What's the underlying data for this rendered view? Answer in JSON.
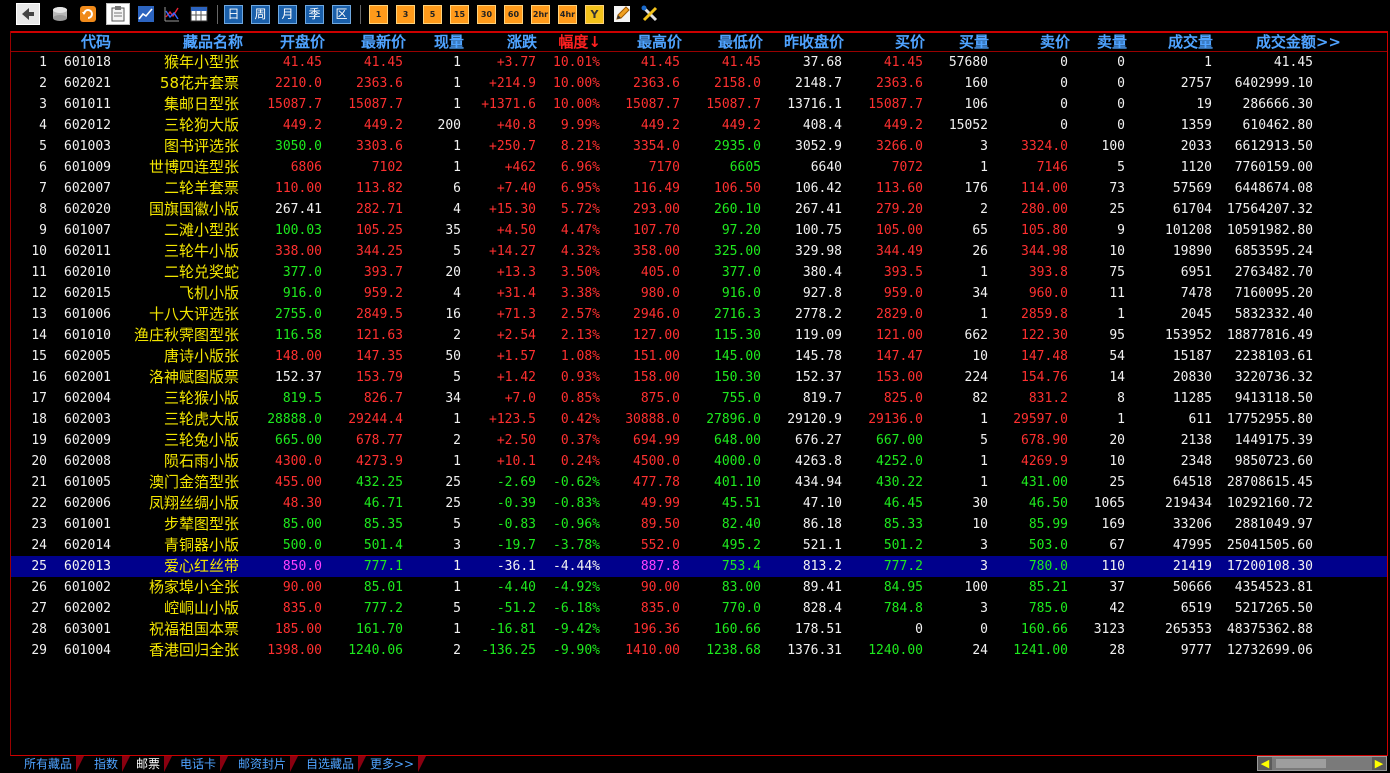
{
  "toolbar": {
    "period_buttons": [
      "日",
      "周",
      "月",
      "季",
      "区"
    ],
    "minute_buttons": [
      "1",
      "3",
      "5",
      "15",
      "30",
      "60",
      "2hr",
      "4hr",
      "Y"
    ]
  },
  "columns": [
    "代码",
    "藏品名称",
    "开盘价",
    "最新价",
    "现量",
    "涨跌",
    "幅度↓",
    "最高价",
    "最低价",
    "昨收盘价",
    "买价",
    "买量",
    "卖价",
    "卖量",
    "成交量",
    "成交金额>>"
  ],
  "colors": {
    "up": "#ff3030",
    "down": "#1eea1e",
    "flat": "#f2f2f2",
    "name": "#f3e600",
    "header": "#4fa3ff",
    "selected_bg": "#00008c"
  },
  "selected_index": 24,
  "rows": [
    {
      "no": "1",
      "code": "601018",
      "name": "猴年小型张",
      "open": "41.45",
      "last": "41.45",
      "vol": "1",
      "chg": "+3.77",
      "pct": "10.01%",
      "high": "41.45",
      "low": "41.45",
      "prev": "37.68",
      "bid": "41.45",
      "bidv": "57680",
      "ask": "0",
      "askv": "0",
      "tvol": "1",
      "amt": "41.45"
    },
    {
      "no": "2",
      "code": "602021",
      "name": "58花卉套票",
      "open": "2210.0",
      "last": "2363.6",
      "vol": "1",
      "chg": "+214.9",
      "pct": "10.00%",
      "high": "2363.6",
      "low": "2158.0",
      "prev": "2148.7",
      "bid": "2363.6",
      "bidv": "160",
      "ask": "0",
      "askv": "0",
      "tvol": "2757",
      "amt": "6402999.10"
    },
    {
      "no": "3",
      "code": "601011",
      "name": "集邮日型张",
      "open": "15087.7",
      "last": "15087.7",
      "vol": "1",
      "chg": "+1371.6",
      "pct": "10.00%",
      "high": "15087.7",
      "low": "15087.7",
      "prev": "13716.1",
      "bid": "15087.7",
      "bidv": "106",
      "ask": "0",
      "askv": "0",
      "tvol": "19",
      "amt": "286666.30"
    },
    {
      "no": "4",
      "code": "602012",
      "name": "三轮狗大版",
      "open": "449.2",
      "last": "449.2",
      "vol": "200",
      "chg": "+40.8",
      "pct": "9.99%",
      "high": "449.2",
      "low": "449.2",
      "prev": "408.4",
      "bid": "449.2",
      "bidv": "15052",
      "ask": "0",
      "askv": "0",
      "tvol": "1359",
      "amt": "610462.80"
    },
    {
      "no": "5",
      "code": "601003",
      "name": "图书评选张",
      "open": "3050.0",
      "last": "3303.6",
      "vol": "1",
      "chg": "+250.7",
      "pct": "8.21%",
      "high": "3354.0",
      "low": "2935.0",
      "prev": "3052.9",
      "bid": "3266.0",
      "bidv": "3",
      "ask": "3324.0",
      "askv": "100",
      "tvol": "2033",
      "amt": "6612913.50"
    },
    {
      "no": "6",
      "code": "601009",
      "name": "世博四连型张",
      "open": "6806",
      "last": "7102",
      "vol": "1",
      "chg": "+462",
      "pct": "6.96%",
      "high": "7170",
      "low": "6605",
      "prev": "6640",
      "bid": "7072",
      "bidv": "1",
      "ask": "7146",
      "askv": "5",
      "tvol": "1120",
      "amt": "7760159.00"
    },
    {
      "no": "7",
      "code": "602007",
      "name": "二轮羊套票",
      "open": "110.00",
      "last": "113.82",
      "vol": "6",
      "chg": "+7.40",
      "pct": "6.95%",
      "high": "116.49",
      "low": "106.50",
      "prev": "106.42",
      "bid": "113.60",
      "bidv": "176",
      "ask": "114.00",
      "askv": "73",
      "tvol": "57569",
      "amt": "6448674.08"
    },
    {
      "no": "8",
      "code": "602020",
      "name": "国旗国徽小版",
      "open": "267.41",
      "last": "282.71",
      "vol": "4",
      "chg": "+15.30",
      "pct": "5.72%",
      "high": "293.00",
      "low": "260.10",
      "prev": "267.41",
      "bid": "279.20",
      "bidv": "2",
      "ask": "280.00",
      "askv": "25",
      "tvol": "61704",
      "amt": "17564207.32"
    },
    {
      "no": "9",
      "code": "601007",
      "name": "二滩小型张",
      "open": "100.03",
      "last": "105.25",
      "vol": "35",
      "chg": "+4.50",
      "pct": "4.47%",
      "high": "107.70",
      "low": "97.20",
      "prev": "100.75",
      "bid": "105.00",
      "bidv": "65",
      "ask": "105.80",
      "askv": "9",
      "tvol": "101208",
      "amt": "10591982.80"
    },
    {
      "no": "10",
      "code": "602011",
      "name": "三轮牛小版",
      "open": "338.00",
      "last": "344.25",
      "vol": "5",
      "chg": "+14.27",
      "pct": "4.32%",
      "high": "358.00",
      "low": "325.00",
      "prev": "329.98",
      "bid": "344.49",
      "bidv": "26",
      "ask": "344.98",
      "askv": "10",
      "tvol": "19890",
      "amt": "6853595.24"
    },
    {
      "no": "11",
      "code": "602010",
      "name": "二轮兑奖蛇",
      "open": "377.0",
      "last": "393.7",
      "vol": "20",
      "chg": "+13.3",
      "pct": "3.50%",
      "high": "405.0",
      "low": "377.0",
      "prev": "380.4",
      "bid": "393.5",
      "bidv": "1",
      "ask": "393.8",
      "askv": "75",
      "tvol": "6951",
      "amt": "2763482.70"
    },
    {
      "no": "12",
      "code": "602015",
      "name": "飞机小版",
      "open": "916.0",
      "last": "959.2",
      "vol": "4",
      "chg": "+31.4",
      "pct": "3.38%",
      "high": "980.0",
      "low": "916.0",
      "prev": "927.8",
      "bid": "959.0",
      "bidv": "34",
      "ask": "960.0",
      "askv": "11",
      "tvol": "7478",
      "amt": "7160095.20"
    },
    {
      "no": "13",
      "code": "601006",
      "name": "十八大评选张",
      "open": "2755.0",
      "last": "2849.5",
      "vol": "16",
      "chg": "+71.3",
      "pct": "2.57%",
      "high": "2946.0",
      "low": "2716.3",
      "prev": "2778.2",
      "bid": "2829.0",
      "bidv": "1",
      "ask": "2859.8",
      "askv": "1",
      "tvol": "2045",
      "amt": "5832332.40"
    },
    {
      "no": "14",
      "code": "601010",
      "name": "渔庄秋霁图型张",
      "open": "116.58",
      "last": "121.63",
      "vol": "2",
      "chg": "+2.54",
      "pct": "2.13%",
      "high": "127.00",
      "low": "115.30",
      "prev": "119.09",
      "bid": "121.00",
      "bidv": "662",
      "ask": "122.30",
      "askv": "95",
      "tvol": "153952",
      "amt": "18877816.49"
    },
    {
      "no": "15",
      "code": "602005",
      "name": "唐诗小版张",
      "open": "148.00",
      "last": "147.35",
      "vol": "50",
      "chg": "+1.57",
      "pct": "1.08%",
      "high": "151.00",
      "low": "145.00",
      "prev": "145.78",
      "bid": "147.47",
      "bidv": "10",
      "ask": "147.48",
      "askv": "54",
      "tvol": "15187",
      "amt": "2238103.61"
    },
    {
      "no": "16",
      "code": "602001",
      "name": "洛神赋图版票",
      "open": "152.37",
      "last": "153.79",
      "vol": "5",
      "chg": "+1.42",
      "pct": "0.93%",
      "high": "158.00",
      "low": "150.30",
      "prev": "152.37",
      "bid": "153.00",
      "bidv": "224",
      "ask": "154.76",
      "askv": "14",
      "tvol": "20830",
      "amt": "3220736.32"
    },
    {
      "no": "17",
      "code": "602004",
      "name": "三轮猴小版",
      "open": "819.5",
      "last": "826.7",
      "vol": "34",
      "chg": "+7.0",
      "pct": "0.85%",
      "high": "875.0",
      "low": "755.0",
      "prev": "819.7",
      "bid": "825.0",
      "bidv": "82",
      "ask": "831.2",
      "askv": "8",
      "tvol": "11285",
      "amt": "9413118.50"
    },
    {
      "no": "18",
      "code": "602003",
      "name": "三轮虎大版",
      "open": "28888.0",
      "last": "29244.4",
      "vol": "1",
      "chg": "+123.5",
      "pct": "0.42%",
      "high": "30888.0",
      "low": "27896.0",
      "prev": "29120.9",
      "bid": "29136.0",
      "bidv": "1",
      "ask": "29597.0",
      "askv": "1",
      "tvol": "611",
      "amt": "17752955.80"
    },
    {
      "no": "19",
      "code": "602009",
      "name": "三轮兔小版",
      "open": "665.00",
      "last": "678.77",
      "vol": "2",
      "chg": "+2.50",
      "pct": "0.37%",
      "high": "694.99",
      "low": "648.00",
      "prev": "676.27",
      "bid": "667.00",
      "bidv": "5",
      "ask": "678.90",
      "askv": "20",
      "tvol": "2138",
      "amt": "1449175.39"
    },
    {
      "no": "20",
      "code": "602008",
      "name": "陨石雨小版",
      "open": "4300.0",
      "last": "4273.9",
      "vol": "1",
      "chg": "+10.1",
      "pct": "0.24%",
      "high": "4500.0",
      "low": "4000.0",
      "prev": "4263.8",
      "bid": "4252.0",
      "bidv": "1",
      "ask": "4269.9",
      "askv": "10",
      "tvol": "2348",
      "amt": "9850723.60"
    },
    {
      "no": "21",
      "code": "601005",
      "name": "澳门金箔型张",
      "open": "455.00",
      "last": "432.25",
      "vol": "25",
      "chg": "-2.69",
      "pct": "-0.62%",
      "high": "477.78",
      "low": "401.10",
      "prev": "434.94",
      "bid": "430.22",
      "bidv": "1",
      "ask": "431.00",
      "askv": "25",
      "tvol": "64518",
      "amt": "28708615.45"
    },
    {
      "no": "22",
      "code": "602006",
      "name": "凤翔丝绸小版",
      "open": "48.30",
      "last": "46.71",
      "vol": "25",
      "chg": "-0.39",
      "pct": "-0.83%",
      "high": "49.99",
      "low": "45.51",
      "prev": "47.10",
      "bid": "46.45",
      "bidv": "30",
      "ask": "46.50",
      "askv": "1065",
      "tvol": "219434",
      "amt": "10292160.72"
    },
    {
      "no": "23",
      "code": "601001",
      "name": "步辇图型张",
      "open": "85.00",
      "last": "85.35",
      "vol": "5",
      "chg": "-0.83",
      "pct": "-0.96%",
      "high": "89.50",
      "low": "82.40",
      "prev": "86.18",
      "bid": "85.33",
      "bidv": "10",
      "ask": "85.99",
      "askv": "169",
      "tvol": "33206",
      "amt": "2881049.97"
    },
    {
      "no": "24",
      "code": "602014",
      "name": "青铜器小版",
      "open": "500.0",
      "last": "501.4",
      "vol": "3",
      "chg": "-19.7",
      "pct": "-3.78%",
      "high": "552.0",
      "low": "495.2",
      "prev": "521.1",
      "bid": "501.2",
      "bidv": "3",
      "ask": "503.0",
      "askv": "67",
      "tvol": "47995",
      "amt": "25041505.60"
    },
    {
      "no": "25",
      "code": "602013",
      "name": "爱心红丝带",
      "open": "850.0",
      "last": "777.1",
      "vol": "1",
      "chg": "-36.1",
      "pct": "-4.44%",
      "high": "887.8",
      "low": "753.4",
      "prev": "813.2",
      "bid": "777.2",
      "bidv": "3",
      "ask": "780.0",
      "askv": "110",
      "tvol": "21419",
      "amt": "17200108.30"
    },
    {
      "no": "26",
      "code": "601002",
      "name": "杨家埠小全张",
      "open": "90.00",
      "last": "85.01",
      "vol": "1",
      "chg": "-4.40",
      "pct": "-4.92%",
      "high": "90.00",
      "low": "83.00",
      "prev": "89.41",
      "bid": "84.95",
      "bidv": "100",
      "ask": "85.21",
      "askv": "37",
      "tvol": "50666",
      "amt": "4354523.81"
    },
    {
      "no": "27",
      "code": "602002",
      "name": "崆峒山小版",
      "open": "835.0",
      "last": "777.2",
      "vol": "5",
      "chg": "-51.2",
      "pct": "-6.18%",
      "high": "835.0",
      "low": "770.0",
      "prev": "828.4",
      "bid": "784.8",
      "bidv": "3",
      "ask": "785.0",
      "askv": "42",
      "tvol": "6519",
      "amt": "5217265.50"
    },
    {
      "no": "28",
      "code": "603001",
      "name": "祝福祖国本票",
      "open": "185.00",
      "last": "161.70",
      "vol": "1",
      "chg": "-16.81",
      "pct": "-9.42%",
      "high": "196.36",
      "low": "160.66",
      "prev": "178.51",
      "bid": "0",
      "bidv": "0",
      "ask": "160.66",
      "askv": "3123",
      "tvol": "265353",
      "amt": "48375362.88"
    },
    {
      "no": "29",
      "code": "601004",
      "name": "香港回归全张",
      "open": "1398.00",
      "last": "1240.06",
      "vol": "2",
      "chg": "-136.25",
      "pct": "-9.90%",
      "high": "1410.00",
      "low": "1238.68",
      "prev": "1376.31",
      "bid": "1240.00",
      "bidv": "24",
      "ask": "1241.00",
      "askv": "28",
      "tvol": "9777",
      "amt": "12732699.06"
    }
  ],
  "tabs": [
    {
      "label": "所有藏品",
      "color": "#4fa3ff"
    },
    {
      "label": "指数",
      "color": "#4fa3ff"
    },
    {
      "label": "邮票",
      "color": "#ffffff"
    },
    {
      "label": "电话卡",
      "color": "#4fa3ff"
    },
    {
      "label": "邮资封片",
      "color": "#4fa3ff"
    },
    {
      "label": "自选藏品",
      "color": "#4fa3ff"
    },
    {
      "label": "更多>>",
      "color": "#4fa3ff"
    }
  ],
  "icons": [
    "back-icon",
    "database-icon",
    "refresh-icon",
    "clipboard-icon",
    "line-chart-icon",
    "trend-chart-icon",
    "table-icon",
    "pencil-icon",
    "tools-icon"
  ]
}
